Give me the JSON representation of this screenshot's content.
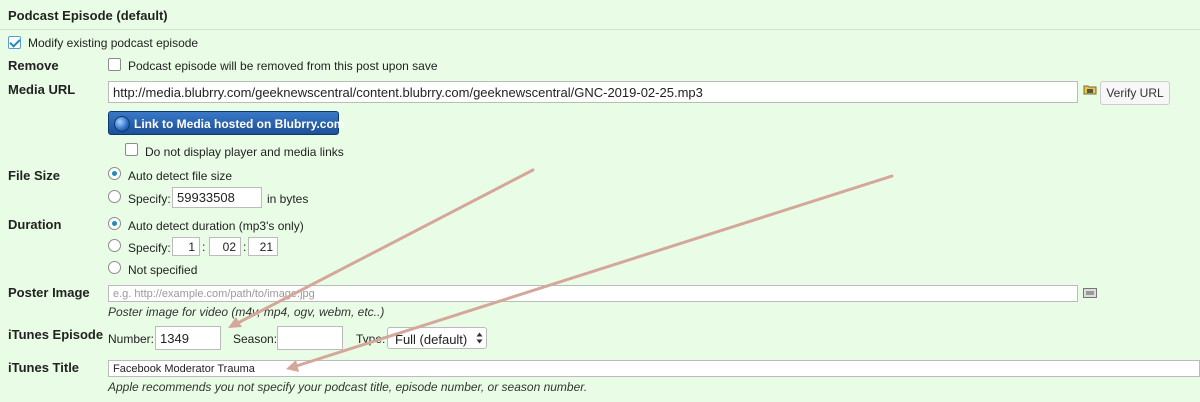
{
  "section_title": "Podcast Episode (default)",
  "modify": {
    "label": "Modify existing podcast episode",
    "checked": true
  },
  "remove": {
    "label": "Remove",
    "checkbox_label": "Podcast episode will be removed from this post upon save"
  },
  "media_url": {
    "label": "Media URL",
    "value": "http://media.blubrry.com/geeknewscentral/content.blubrry.com/geeknewscentral/GNC-2019-02-25.mp3",
    "verify_label": "Verify URL",
    "blubrry_label": "Link to Media hosted on Blubrry.com",
    "no_player_label": "Do not display player and media links"
  },
  "file_size": {
    "label": "File Size",
    "auto_label": "Auto detect file size",
    "specify_label": "Specify:",
    "value": "59933508",
    "unit": "in bytes"
  },
  "duration": {
    "label": "Duration",
    "auto_label": "Auto detect duration (mp3's only)",
    "specify_label": "Specify:",
    "hours": "1",
    "minutes": "02",
    "seconds": "21",
    "sep": ":",
    "not_specified_label": "Not specified"
  },
  "poster": {
    "label": "Poster Image",
    "placeholder": "e.g. http://example.com/path/to/image.jpg",
    "hint": "Poster image for video (m4v, mp4, ogv, webm, etc..)"
  },
  "itunes_episode": {
    "label": "iTunes Episode",
    "number_label": "Number:",
    "number_value": "1349",
    "season_label": "Season:",
    "season_value": "",
    "type_label": "Type:",
    "type_value": "Full (default)"
  },
  "itunes_title": {
    "label": "iTunes Title",
    "value": "Facebook Moderator Trauma",
    "hint": "Apple recommends you not specify your podcast title, episode number, or season number."
  },
  "colors": {
    "background": "#e9fde6",
    "arrow": "#d4a79a",
    "accent": "#1e8cbe"
  }
}
